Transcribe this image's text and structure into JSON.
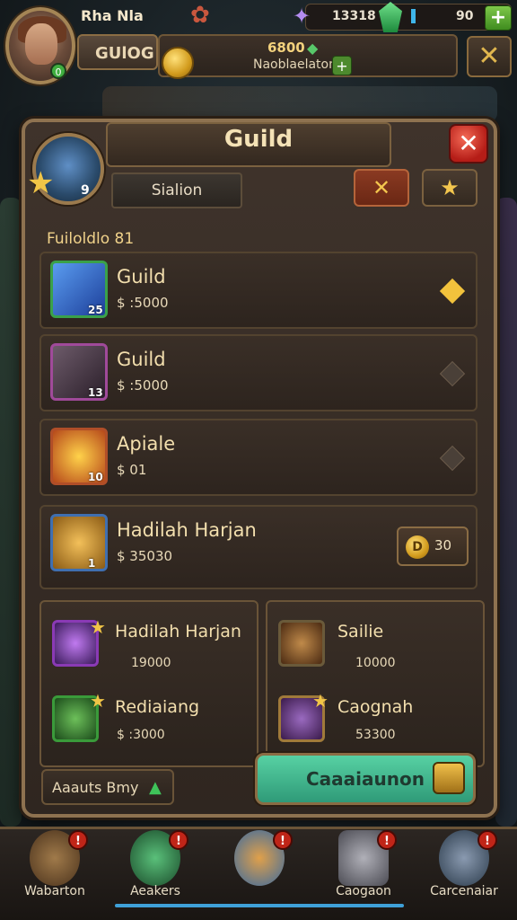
{
  "topbar": {
    "player_name": "Rha Nla",
    "guild_name": "GUlOG",
    "gold_amount": "6800",
    "sub_label": "Naoblaelaton",
    "resource_1": "13318",
    "resource_2": "90"
  },
  "panel": {
    "title": "Guild",
    "tab_label": "Sialion",
    "emblem_level": "9",
    "section_label": "Fuiloldlo 81"
  },
  "rows": [
    {
      "name": "Guild",
      "price": "$ :5000",
      "count": "25"
    },
    {
      "name": "Guild",
      "price": "$ :5000",
      "count": "13"
    },
    {
      "name": "Apiale",
      "price": "$ 01",
      "count": "10"
    },
    {
      "name": "Hadilah Harjan",
      "price": "$ 35030",
      "count": "1"
    }
  ],
  "claim": {
    "coin": "D",
    "value": "30"
  },
  "sub_left": [
    {
      "name": "Hadilah Harjan",
      "price": "19000"
    },
    {
      "name": "Rediaiang",
      "price": "$ :3000"
    }
  ],
  "sub_right": [
    {
      "name": "Sailie",
      "price": "10000"
    },
    {
      "name": "Caognah",
      "price": "53300"
    }
  ],
  "bottom": {
    "plate_label": "Aaauts Bmy",
    "confirm_label": "Caaaiaunon"
  },
  "nav": [
    {
      "label": "Wabarton",
      "badge": "!"
    },
    {
      "label": "Aeakers",
      "badge": "!"
    },
    {
      "label": "",
      "badge": "!"
    },
    {
      "label": "Caogaon",
      "badge": "!"
    },
    {
      "label": "Carcenaiar",
      "badge": "!"
    }
  ],
  "colors": {
    "panel_bg": "#3f332b",
    "border": "#8e7250",
    "confirm": "#57d1a3",
    "close_red": "#d03a2a",
    "gold": "#f3c64e"
  }
}
